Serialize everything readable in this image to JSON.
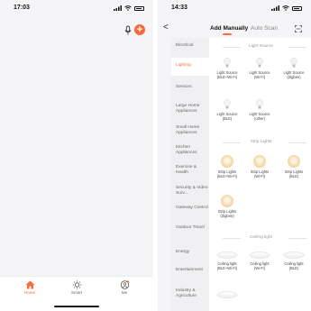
{
  "left_screen": {
    "status_time": "17:03",
    "tabs": [
      {
        "label": "Home"
      },
      {
        "label": "Smart"
      },
      {
        "label": "Me"
      }
    ]
  },
  "right_screen": {
    "status_time": "14:33",
    "back_glyph": "<",
    "top_tabs": [
      "Add Manually",
      "Auto Scan"
    ],
    "sidebar": [
      "Electrical",
      "Lighting",
      "Sensors",
      "Large Home Appliances",
      "Small Home Appliances",
      "Kitchen Appliances",
      "Exercise & Health",
      "Security & Video Surv...",
      "Gateway Control",
      "Outdoor Travel",
      "Energy",
      "Entertainment",
      "Industry & Agriculture"
    ],
    "sections": [
      {
        "title": "Light Source",
        "items": [
          [
            "Light Source",
            "(BLE+Wi-Fi)"
          ],
          [
            "Light Source",
            "(Wi-Fi)"
          ],
          [
            "Light Source",
            "(Zigbee)"
          ],
          [
            "Light Source",
            "(BLE)"
          ],
          [
            "Light Source",
            "(other)"
          ]
        ]
      },
      {
        "title": "Strip Lights",
        "items": [
          [
            "Strip Lights",
            "(BLE+Wi-Fi)"
          ],
          [
            "Strip Lights",
            "(Wi-Fi)"
          ],
          [
            "Strip Lights",
            "(BLE)"
          ],
          [
            "Strip Lights",
            "(Zigbee)"
          ]
        ]
      },
      {
        "title": "Ceiling light",
        "items": [
          [
            "Ceiling light",
            "(BLE+Wi-Fi)"
          ],
          [
            "Ceiling light",
            "(Wi-Fi)"
          ],
          [
            "Ceiling light",
            "(BLE)"
          ]
        ]
      }
    ]
  },
  "colors": {
    "accent": "#f76b3c",
    "background": "#f5f5f7",
    "sidebar_bg": "#f0f0f2"
  }
}
